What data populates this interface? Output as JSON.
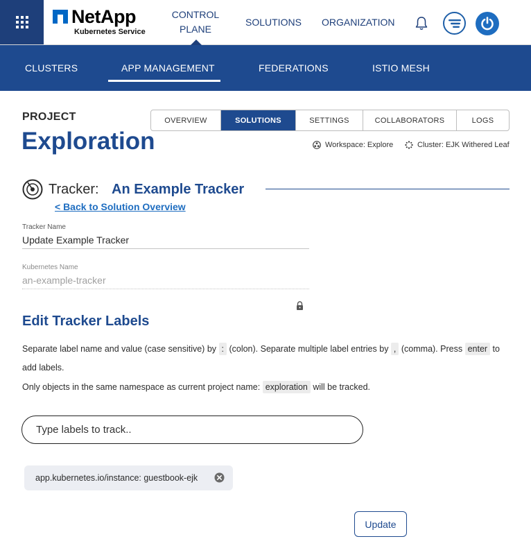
{
  "brand": {
    "name": "NetApp",
    "subtitle": "Kubernetes Service",
    "accent": "#1e4a8f"
  },
  "topnav": {
    "control_plane_line1": "CONTROL",
    "control_plane_line2": "PLANE",
    "solutions": "SOLUTIONS",
    "organization": "ORGANIZATION"
  },
  "subnav": {
    "items": [
      "CLUSTERS",
      "APP MANAGEMENT",
      "FEDERATIONS",
      "ISTIO MESH"
    ],
    "active": "APP MANAGEMENT"
  },
  "project": {
    "label": "PROJECT",
    "title": "Exploration",
    "tabs": [
      "OVERVIEW",
      "SOLUTIONS",
      "SETTINGS",
      "COLLABORATORS",
      "LOGS"
    ],
    "active_tab": "SOLUTIONS",
    "workspace": "Workspace: Explore",
    "cluster": "Cluster: EJK Withered Leaf"
  },
  "tracker": {
    "label": "Tracker:",
    "name": "An Example Tracker",
    "back_link": "< Back to Solution Overview",
    "fields": {
      "tracker_name_label": "Tracker Name",
      "tracker_name_value": "Update Example Tracker",
      "k8s_name_label": "Kubernetes Name",
      "k8s_name_value": "an-example-tracker"
    }
  },
  "labels": {
    "title": "Edit Tracker Labels",
    "p1_a": "Separate label name and value (case sensitive) by ",
    "p1_colon": ":",
    "p1_b": " (colon). Separate multiple label entries by ",
    "p1_comma": ",",
    "p1_c": " (comma). Press ",
    "p1_enter": "enter",
    "p1_d": " to",
    "p1_e": "add labels.",
    "p2_a": "Only objects in the same namespace as current project name: ",
    "p2_project": "exploration",
    "p2_b": " will be tracked.",
    "input_placeholder": "Type labels to track..",
    "chips": [
      "app.kubernetes.io/instance: guestbook-ejk"
    ],
    "update_button": "Update"
  }
}
